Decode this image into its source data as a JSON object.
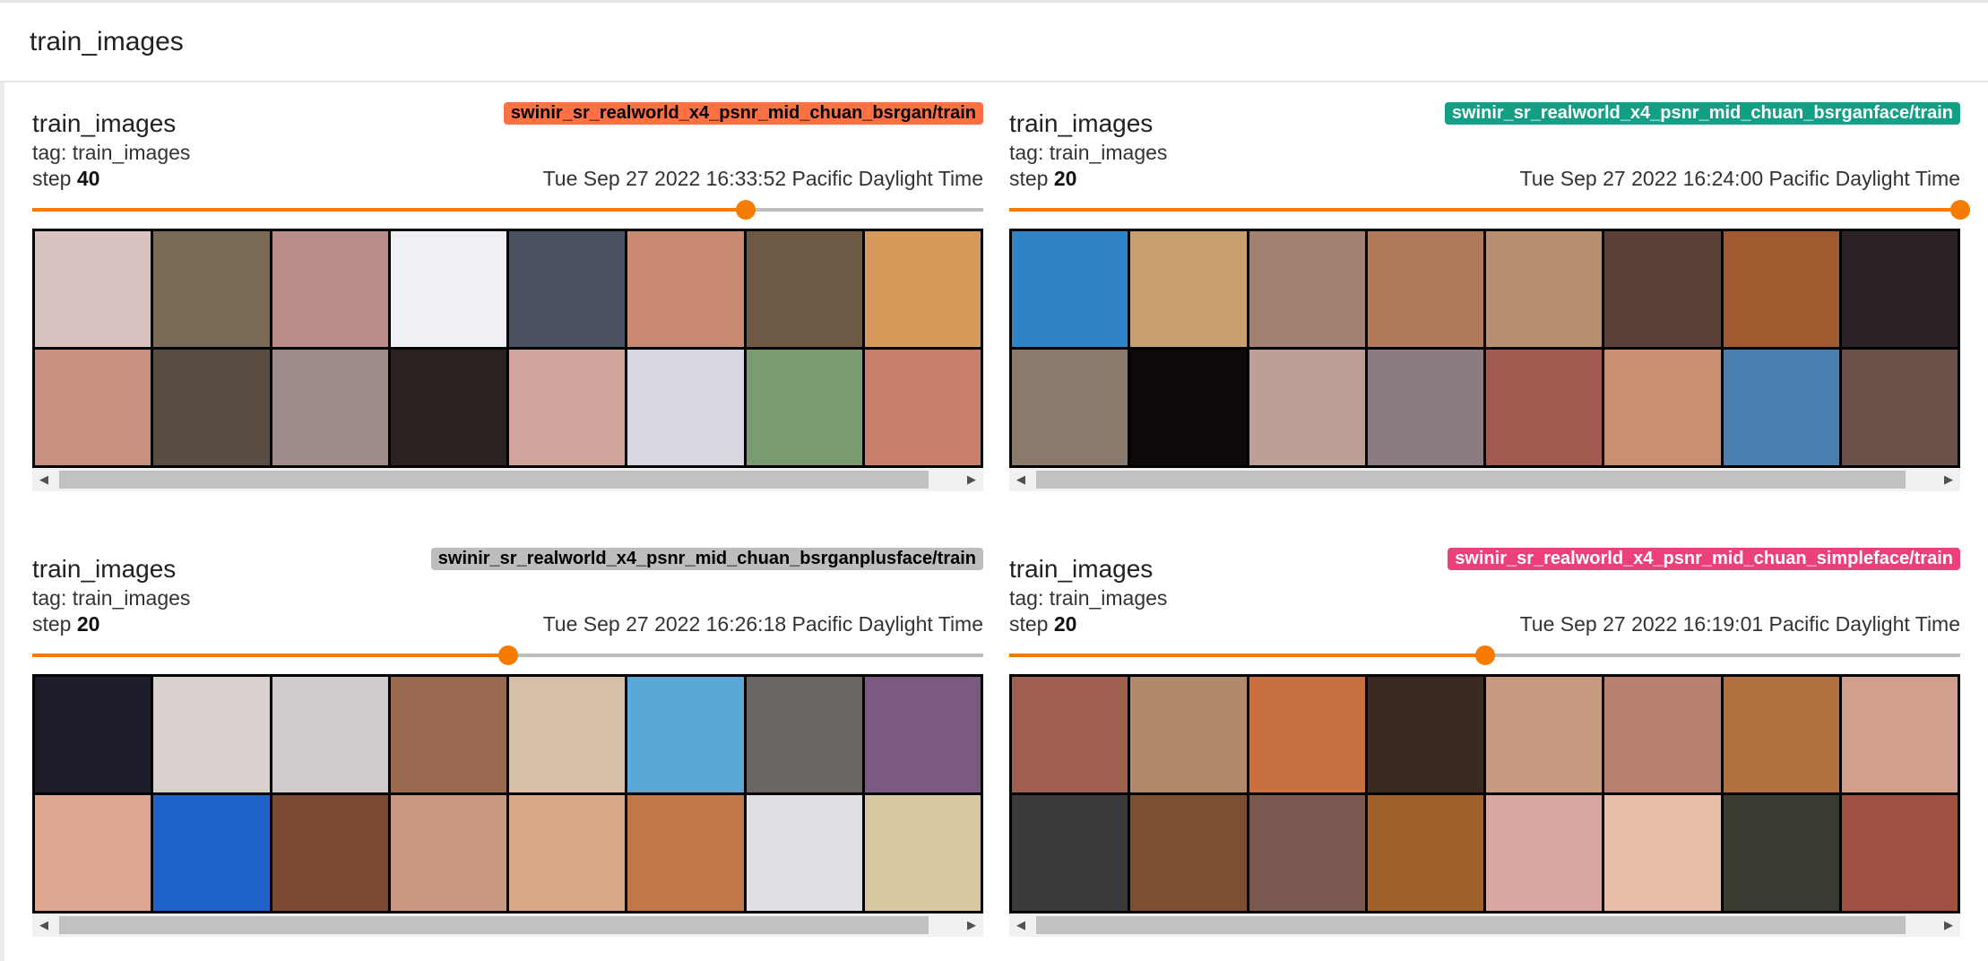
{
  "section": {
    "title": "train_images"
  },
  "cards": [
    {
      "title": "train_images",
      "tag": "tag: train_images",
      "step_label": "step",
      "step": "40",
      "timestamp": "Tue Sep 27 2022 16:33:52 Pacific Daylight Time",
      "run": "swinir_sr_realworld_x4_psnr_mid_chuan_bsrgan/train",
      "run_color": "#ff7043",
      "run_text_color": "#000000",
      "slider_fraction": 0.75,
      "thumbnails": [
        "#d8c3c0",
        "#7a6a55",
        "#b88c8a",
        "#f0f0f4",
        "#4a5260",
        "#c88a70",
        "#6e5a44",
        "#d89a5a",
        "#c89080",
        "#5a4e44",
        "#a08c88",
        "#2a221e",
        "#d0a49a",
        "#d8d8e0",
        "#7a9a70",
        "#c8806a"
      ]
    },
    {
      "title": "train_images",
      "tag": "tag: train_images",
      "step_label": "step",
      "step": "20",
      "timestamp": "Tue Sep 27 2022 16:24:00 Pacific Daylight Time",
      "run": "swinir_sr_realworld_x4_psnr_mid_chuan_bsrganface/train",
      "run_color": "#12a085",
      "run_text_color": "#ffffff",
      "slider_fraction": 1.0,
      "thumbnails": [
        "#2f84c8",
        "#c8a070",
        "#a48070",
        "#b07a5a",
        "#b89070",
        "#5a4038",
        "#a05a30",
        "#2a2226",
        "#8a7a6c",
        "#0e0a0a",
        "#bca098",
        "#8a7c80",
        "#a05a50",
        "#c89070",
        "#4a80b0",
        "#6a5048"
      ]
    },
    {
      "title": "train_images",
      "tag": "tag: train_images",
      "step_label": "step",
      "step": "20",
      "timestamp": "Tue Sep 27 2022 16:26:18 Pacific Daylight Time",
      "run": "swinir_sr_realworld_x4_psnr_mid_chuan_bsrganplusface/train",
      "run_color": "#bdbdbd",
      "run_text_color": "#000000",
      "slider_fraction": 0.5,
      "thumbnails": [
        "#1e1e2a",
        "#d8d0cc",
        "#d0cccc",
        "#9a6a50",
        "#d8c0a8",
        "#5aa8d8",
        "#6a6462",
        "#7a5a80",
        "#e0a890",
        "#1f62c8",
        "#7a4a30",
        "#c89880",
        "#d8a888",
        "#c07848",
        "#e0e0e4",
        "#d8c8a0"
      ]
    },
    {
      "title": "train_images",
      "tag": "tag: train_images",
      "step_label": "step",
      "step": "20",
      "timestamp": "Tue Sep 27 2022 16:19:01 Pacific Daylight Time",
      "run": "swinir_sr_realworld_x4_psnr_mid_chuan_simpleface/train",
      "run_color": "#ec407a",
      "run_text_color": "#ffffff",
      "slider_fraction": 0.5,
      "thumbnails": [
        "#a06050",
        "#b08a6a",
        "#c87040",
        "#3a2a22",
        "#c89a80",
        "#b88070",
        "#b07040",
        "#d0a08c",
        "#3a3a3a",
        "#7a5030",
        "#7a5a50",
        "#a0602a",
        "#d8a8a0",
        "#e8c0a8",
        "#3a3a30",
        "#a05040"
      ]
    }
  ]
}
